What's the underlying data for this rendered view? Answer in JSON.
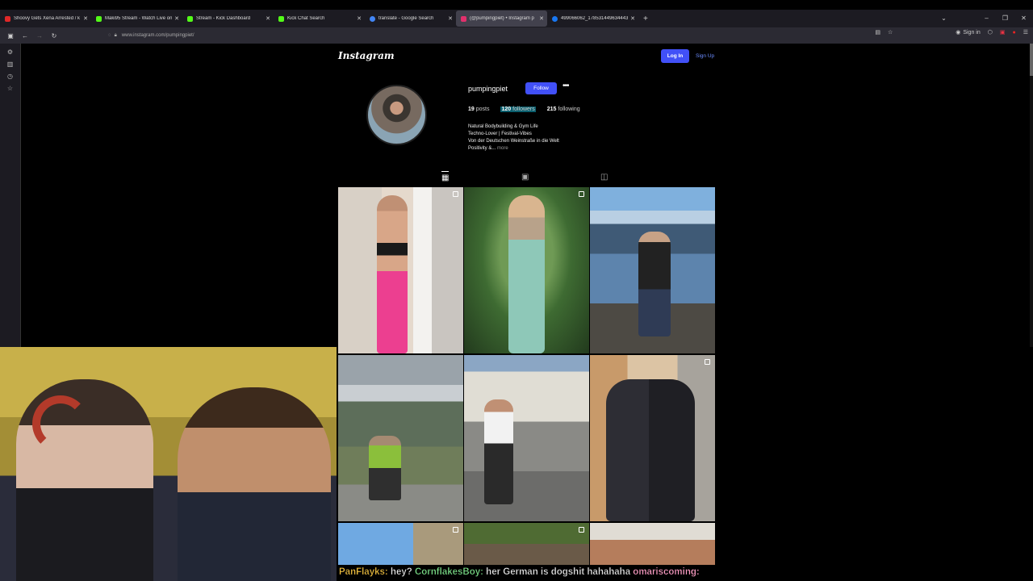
{
  "browser": {
    "tabs": [
      {
        "title": "Shoovy Gets Xena Arrested / k",
        "favicon_color": "#e02828"
      },
      {
        "title": "Maki95 Stream - Watch Live on",
        "favicon_color": "#53fc18"
      },
      {
        "title": "Stream - Kick Dashboard",
        "favicon_color": "#53fc18"
      },
      {
        "title": "Kick Chat Search",
        "favicon_color": "#53fc18"
      },
      {
        "title": "translate - Google Search",
        "favicon_color": "#4285f4"
      },
      {
        "title": "(@pumpingpiet) • Instagram p",
        "favicon_color": "#e1306c",
        "active": true
      },
      {
        "title": "499066062_178531449634443",
        "favicon_color": "#1877f2"
      }
    ],
    "new_tab": "+",
    "url": "www.instagram.com/pumpingpiet/",
    "sign_in": "Sign in",
    "controls": {
      "minimize": "–",
      "restore": "❐",
      "close": "✕"
    }
  },
  "instagram": {
    "logo": "Instagram",
    "login_label": "Log In",
    "signup_label": "Sign Up",
    "profile": {
      "username": "pumpingpiet",
      "follow_label": "Follow",
      "more": "•••",
      "posts_count": "19",
      "posts_label": "posts",
      "followers_count": "120",
      "followers_label": "followers",
      "following_count": "215",
      "following_label": "following",
      "bio": [
        "Natural Bodybuilding & Gym Life",
        "Techno-Lover | Festival-Vibes",
        "Von der Deutschen Weinstraße in die Welt",
        "Positivity &..."
      ],
      "bio_more": "more"
    },
    "tabs": {
      "posts_icon": "▦",
      "reels_icon": "▣",
      "tagged_icon": "◫"
    }
  },
  "chat_line": {
    "user1": "PanFlayks:",
    "msg1": " hey? ",
    "user2": "CornflakesBoy:",
    "msg2": " her German is dogshit hahahaha ",
    "user3": "omariscoming:"
  },
  "colors": {
    "accent": "#4150f7",
    "background": "#000000",
    "followers_highlight": "#0b5f6e"
  }
}
